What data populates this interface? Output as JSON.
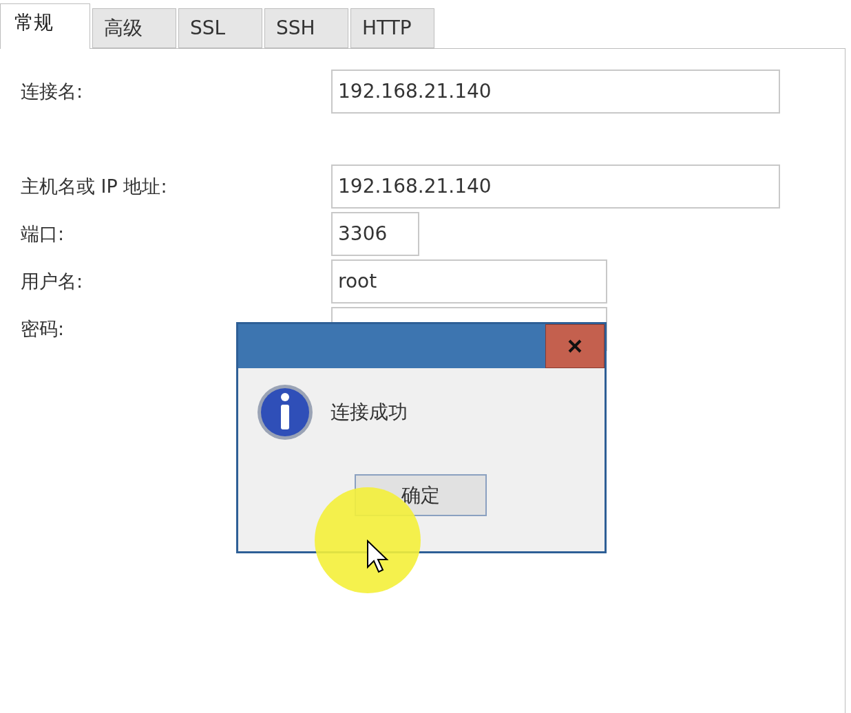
{
  "tabs": [
    {
      "label": "常规",
      "selected": true
    },
    {
      "label": "高级",
      "selected": false
    },
    {
      "label": "SSL",
      "selected": false
    },
    {
      "label": "SSH",
      "selected": false
    },
    {
      "label": "HTTP",
      "selected": false
    }
  ],
  "fields": [
    {
      "label": "连接名:",
      "value": "192.168.21.140"
    },
    {
      "label": "主机名或 IP 地址:",
      "value": "192.168.21.140"
    },
    {
      "label": "端口:",
      "value": "3306"
    },
    {
      "label": "用户名:",
      "value": "root"
    },
    {
      "label": "密码:"
    }
  ],
  "dialog": {
    "message": "连接成功",
    "button": "确定"
  }
}
